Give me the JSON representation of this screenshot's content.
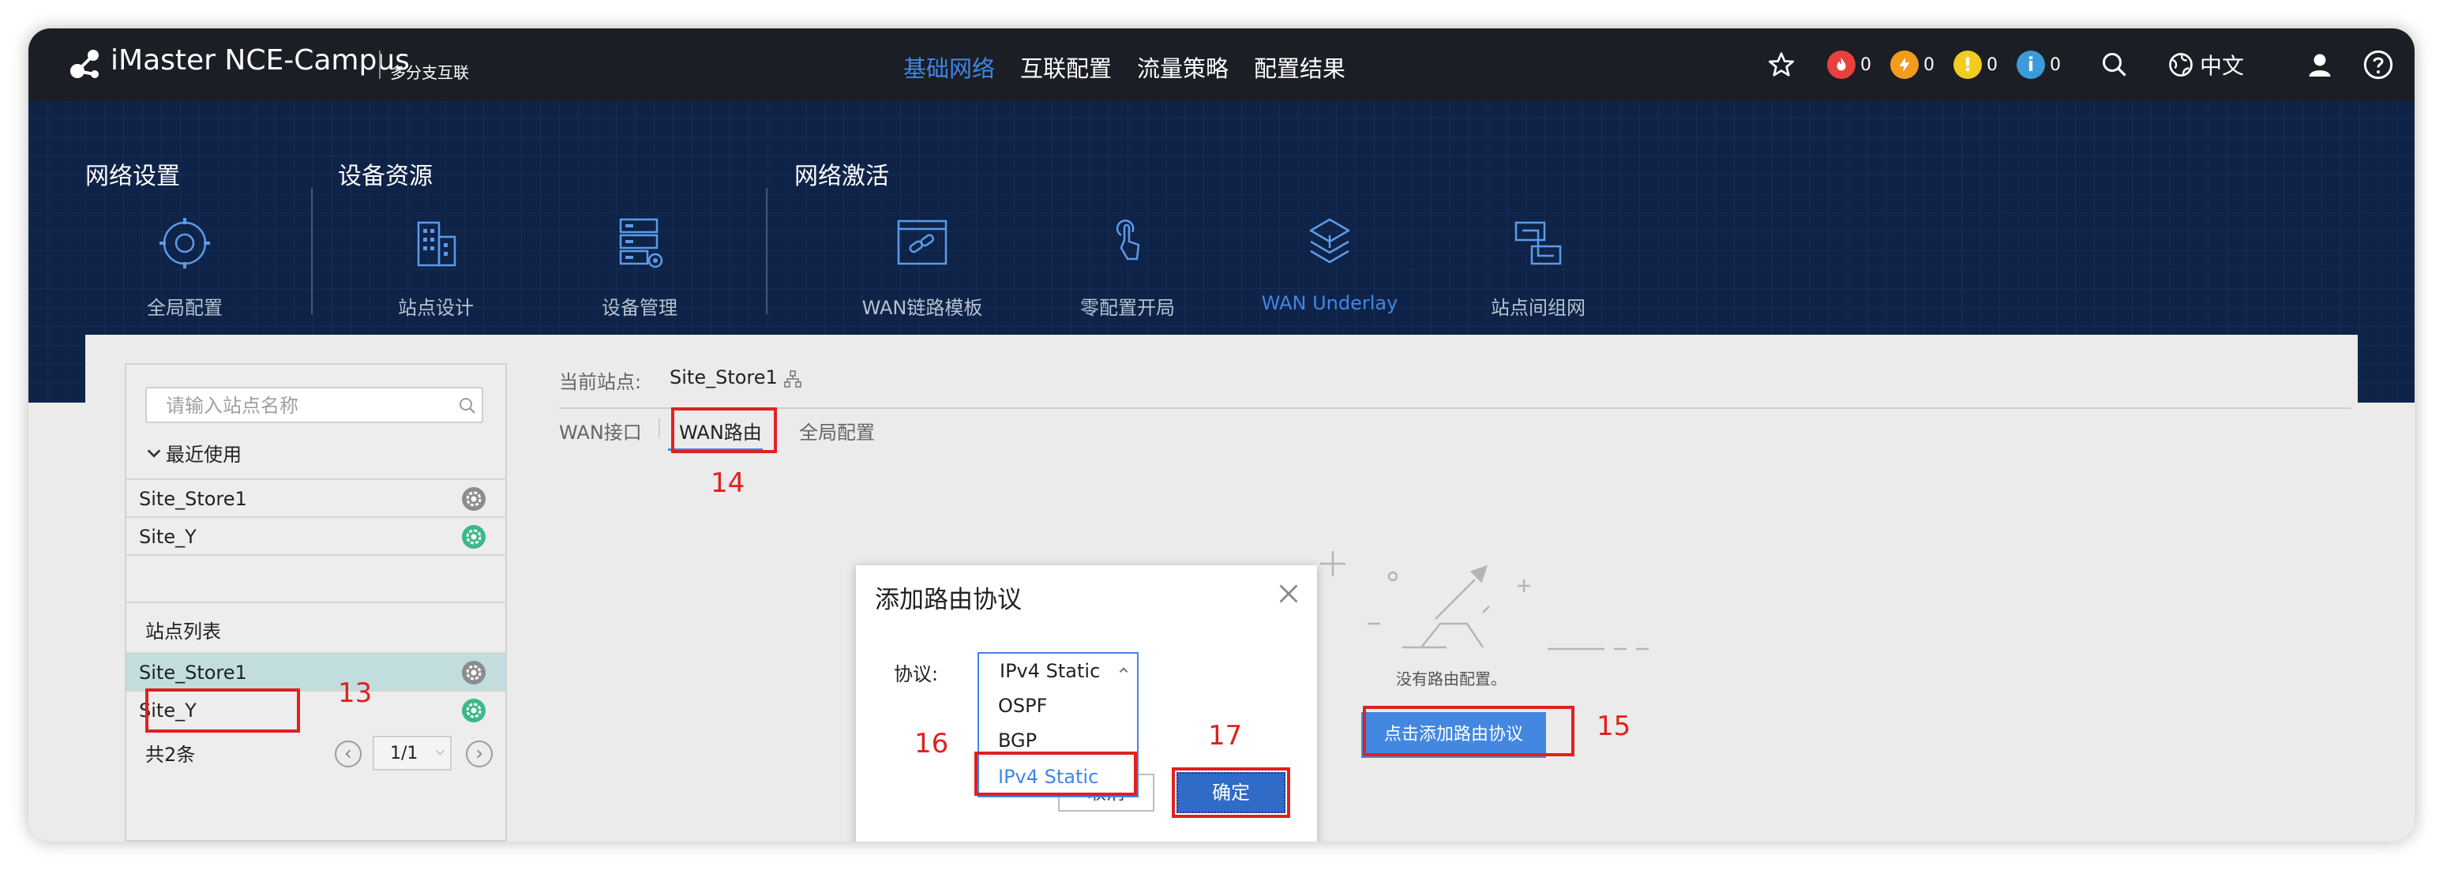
{
  "topbar": {
    "brand": "iMaster NCE-Campus",
    "subtitle": "多分支互联",
    "nav": [
      {
        "label": "基础网络",
        "active": true
      },
      {
        "label": "互联配置",
        "active": false
      },
      {
        "label": "流量策略",
        "active": false
      },
      {
        "label": "配置结果",
        "active": false
      }
    ],
    "alarms": {
      "critical": "0",
      "major": "0",
      "minor": "0",
      "info": "0"
    },
    "language": "中文"
  },
  "banner": {
    "sections": {
      "network": "网络设置",
      "resources": "设备资源",
      "activation": "网络激活"
    },
    "tiles": [
      {
        "label": "全局配置",
        "icon": "globe-settings-icon",
        "active": false
      },
      {
        "label": "站点设计",
        "icon": "building-icon",
        "active": false
      },
      {
        "label": "设备管理",
        "icon": "server-icon",
        "active": false
      },
      {
        "label": "WAN链路模板",
        "icon": "link-template-icon",
        "active": false
      },
      {
        "label": "零配置开局",
        "icon": "touch-icon",
        "active": false
      },
      {
        "label": "WAN Underlay",
        "icon": "underlay-icon",
        "active": true
      },
      {
        "label": "站点间组网",
        "icon": "site-network-icon",
        "active": false
      }
    ]
  },
  "left_panel": {
    "search_placeholder": "请输入站点名称",
    "recent_title": "最近使用",
    "recent": [
      {
        "name": "Site_Store1",
        "status": "gray"
      },
      {
        "name": "Site_Y",
        "status": "green"
      }
    ],
    "list_title": "站点列表",
    "list": [
      {
        "name": "Site_Store1",
        "status": "gray",
        "selected": true
      },
      {
        "name": "Site_Y",
        "status": "green",
        "selected": false
      }
    ],
    "total": "共2条",
    "page": "1/1"
  },
  "main": {
    "current_site_label": "当前站点:",
    "current_site": "Site_Store1",
    "tabs": [
      {
        "label": "WAN接口",
        "active": false
      },
      {
        "label": "WAN路由",
        "active": true
      },
      {
        "label": "全局配置",
        "active": false
      }
    ],
    "empty_text": "没有路由配置。",
    "add_button": "点击添加路由协议"
  },
  "dialog": {
    "title": "添加路由协议",
    "protocol_label": "协议:",
    "selected_value": "IPv4 Static",
    "options": [
      "OSPF",
      "BGP",
      "IPv4 Static"
    ],
    "cancel_label": "取消",
    "ok_label": "确定"
  },
  "annotations": {
    "n13": "13",
    "n14": "14",
    "n15": "15",
    "n16": "16",
    "n17": "17"
  },
  "colors": {
    "accent": "#3f86e6",
    "topbar": "#1b1e24",
    "banner": "#0e2347",
    "annotation_red": "#e02020",
    "status_green": "#3cb88a",
    "status_gray": "#8c8c8c",
    "alarm_critical": "#e8413c",
    "alarm_major": "#f29c1f",
    "alarm_minor": "#f2cc1f",
    "alarm_info": "#3b9ad9"
  }
}
